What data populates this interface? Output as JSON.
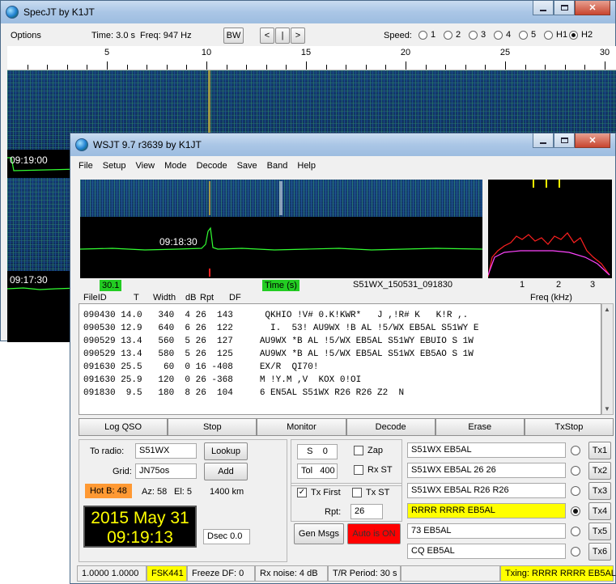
{
  "specjt": {
    "title": "SpecJT    by K1JT",
    "options_label": "Options",
    "time_label": "Time:  3.0 s",
    "freq_label": "Freq: 947 Hz",
    "bw_button": "BW",
    "nav_left": "<",
    "nav_mid": "|",
    "nav_right": ">",
    "speed_label": "Speed:",
    "speed_options": [
      "1",
      "2",
      "3",
      "4",
      "5",
      "H1",
      "H2"
    ],
    "speed_selected": "H2",
    "scale_labels": [
      "5",
      "10",
      "15",
      "20",
      "25",
      "30"
    ],
    "time_marks": [
      "09:19:00",
      "09:17:30"
    ]
  },
  "wsjt": {
    "title": "WSJT 9.7    r3639    by K1JT",
    "menu": [
      "File",
      "Setup",
      "View",
      "Mode",
      "Decode",
      "Save",
      "Band",
      "Help"
    ],
    "waterfall_time": "09:18:30",
    "indicator_left": "30.1",
    "indicator_time": "Time (s)",
    "file_name": "S51WX_150531_091830",
    "freq_ticks": [
      "1",
      "2",
      "3"
    ],
    "freq_label": "Freq (kHz)",
    "columns": [
      "FileID",
      "T",
      "Width",
      "dB",
      "Rpt",
      "DF"
    ],
    "decode_lines": [
      "090430 14.0   340  4 26  143      QKHIO !V# 0.K!KWR*   J ,!R# K   K!R ,.",
      "090530 12.9   640  6 26  122       I.  53! AU9WX !B AL !5/WX EB5AL S51WY E",
      "090529 13.4   560  5 26  127     AU9WX *B AL !5/WX EB5AL S51WY EBUIO S 1W",
      "090529 13.4   580  5 26  125     AU9WX *B AL !5/WX EB5AL S51WX EB5AO S 1W",
      "091630 25.5    60  0 16 -408     EX/R  QI70!",
      "091630 25.9   120  0 26 -368     M !Y.M ,V  KOX 0!OI",
      "091830  9.5   180  8 26  104     6 EN5AL S51WX R26 R26 Z2  N"
    ],
    "buttons": {
      "log_qso": "Log QSO",
      "stop": "Stop",
      "monitor": "Monitor",
      "decode": "Decode",
      "erase": "Erase",
      "txstop": "TxStop"
    },
    "station": {
      "to_radio_label": "To radio:",
      "to_radio_value": "S51WX",
      "lookup_button": "Lookup",
      "grid_label": "Grid:",
      "grid_value": "JN75os",
      "add_button": "Add",
      "hotb": "Hot B: 48",
      "az": "Az: 58",
      "el": "El: 5",
      "distance": "1400 km",
      "date": "2015 May 31",
      "time": "09:19:13",
      "dsec": "Dsec  0.0"
    },
    "controls": {
      "s_label": "S",
      "s_value": "0",
      "zap_label": "Zap",
      "tol_label": "Tol",
      "tol_value": "400",
      "rxst_label": "Rx ST",
      "txfirst_label": "Tx First",
      "txst_label": "Tx ST",
      "rpt_label": "Rpt:",
      "rpt_value": "26",
      "gen_msgs": "Gen Msgs",
      "auto_on": "Auto is  ON"
    },
    "tx_messages": [
      {
        "text": "S51WX EB5AL",
        "button": "Tx1"
      },
      {
        "text": "S51WX EB5AL 26 26",
        "button": "Tx2"
      },
      {
        "text": "S51WX EB5AL R26 R26",
        "button": "Tx3"
      },
      {
        "text": "RRRR RRRR EB5AL",
        "button": "Tx4"
      },
      {
        "text": "73 EB5AL",
        "button": "Tx5"
      },
      {
        "text": "CQ EB5AL",
        "button": "Tx6"
      }
    ],
    "tx_selected": 3,
    "status": {
      "levels": "1.0000 1.0000",
      "mode": "FSK441",
      "freeze": "Freeze DF:   0",
      "rxnoise": "Rx noise:  4 dB",
      "period": "T/R Period: 30 s",
      "txing": "Txing:  RRRR RRRR EB5AL"
    },
    "colors": {
      "accent_yellow": "#ffff00",
      "indicator_green": "#22cc22",
      "auto_red": "#ff0000",
      "hotb_orange": "#ff9933"
    }
  }
}
